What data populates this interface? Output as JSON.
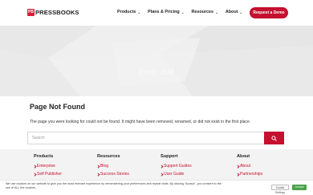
{
  "header": {
    "logo_mark": "PB",
    "logo_text": "PRESSBOOKS",
    "nav": [
      {
        "label": "Products"
      },
      {
        "label": "Plans & Pricing"
      },
      {
        "label": "Resources"
      },
      {
        "label": "About"
      }
    ],
    "cta_label": "Request a Demo",
    "brand_color": "#c5102e"
  },
  "hero": {
    "title": "Error 404"
  },
  "main": {
    "heading": "Page Not Found",
    "message": "The page you were looking for could not be found. It might have been removed, renamed, or did not exist in the first place.",
    "search_placeholder": "Search"
  },
  "footer": {
    "products": {
      "title": "Products",
      "links": [
        "Enterprise",
        "Self Publisher"
      ]
    },
    "resources": {
      "title": "Resources",
      "links": [
        "Blog",
        "Success Stories"
      ]
    },
    "support": {
      "title": "Support",
      "links": [
        "Support Guides",
        "User Guide"
      ]
    },
    "about": {
      "title": "About",
      "links": [
        "About",
        "Partnerships"
      ]
    }
  },
  "cookie": {
    "text": "We use cookies on our website to give you the most relevant experience by remembering your preferences and repeat visits. By clicking “Accept”, you consent to the use of ALL the cookies.",
    "settings_label": "Cookie Settings",
    "accept_label": "Accept",
    "accept_color": "#4aa14a"
  }
}
